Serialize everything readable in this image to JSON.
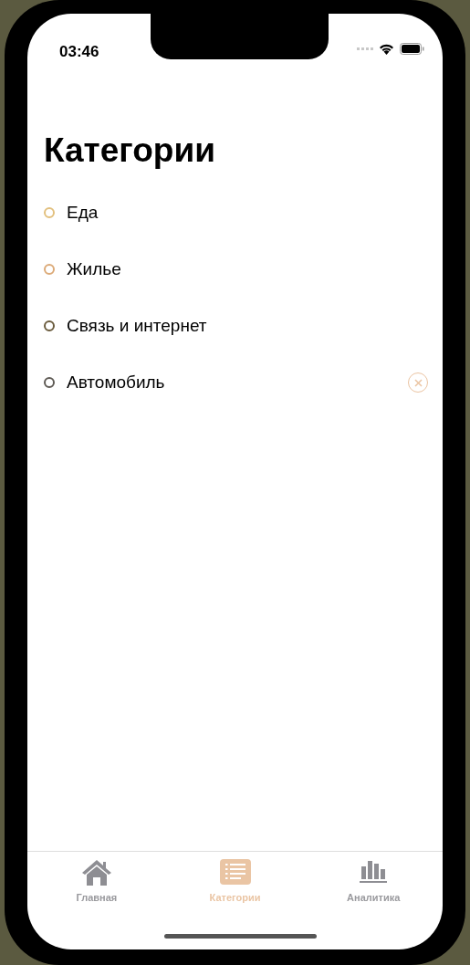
{
  "status_bar": {
    "time": "03:46"
  },
  "title": "Категории",
  "categories": [
    {
      "name": "Еда",
      "color": "#e2c07e",
      "deletable": false
    },
    {
      "name": "Жилье",
      "color": "#dcaa78",
      "deletable": false
    },
    {
      "name": "Связь и интернет",
      "color": "#6b5c3e",
      "deletable": false
    },
    {
      "name": "Автомобиль",
      "color": "#5e5a54",
      "deletable": true
    }
  ],
  "tabs": [
    {
      "label": "Главная",
      "kind": "home",
      "selected": false
    },
    {
      "label": "Категории",
      "kind": "list",
      "selected": true
    },
    {
      "label": "Аналитика",
      "kind": "chart",
      "selected": false
    }
  ]
}
